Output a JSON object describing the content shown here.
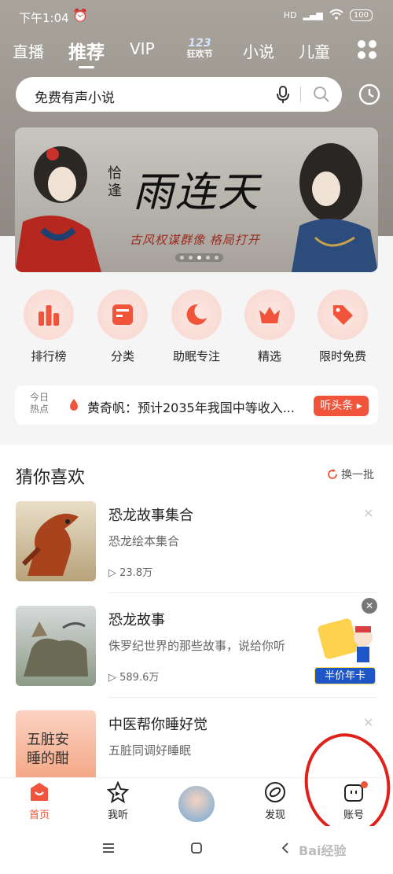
{
  "status_bar": {
    "time": "下午1:04",
    "network": "HD",
    "battery": "100"
  },
  "nav": {
    "tabs": [
      "直播",
      "推荐",
      "VIP",
      "小说",
      "儿童"
    ],
    "active_tab": "推荐",
    "festival_badge_number": "123",
    "festival_badge_text": "狂欢节"
  },
  "search": {
    "placeholder": "免费有声小说"
  },
  "banner": {
    "title": "雨连天",
    "subtitle": "恰逢",
    "slogan": "古风权谋群像 格局打开",
    "dot_count": 5,
    "active_dot": 2
  },
  "quick_entries": [
    {
      "label": "排行榜",
      "icon": "bar-chart-icon"
    },
    {
      "label": "分类",
      "icon": "category-icon"
    },
    {
      "label": "助眠专注",
      "icon": "moon-icon"
    },
    {
      "label": "精选",
      "icon": "crown-icon"
    },
    {
      "label": "限时免费",
      "icon": "tag-icon"
    }
  ],
  "news": {
    "tag_line1": "今日",
    "tag_line2": "热点",
    "headline": "黄奇帆：预计2035年我国中等收入...",
    "button": "听头条 ▸"
  },
  "guess": {
    "title": "猜你喜欢",
    "refresh": "换一批",
    "items": [
      {
        "title": "恐龙故事集合",
        "desc": "恐龙绘本集合",
        "plays": "23.8万"
      },
      {
        "title": "恐龙故事",
        "desc": "侏罗纪世界的那些故事，说给你听",
        "plays": "589.6万"
      },
      {
        "title": "中医帮你睡好觉",
        "desc": "五脏同调好睡眠",
        "plays": "",
        "cover_text": "五脏安睡的酣"
      }
    ]
  },
  "promo": {
    "label": "半价年卡"
  },
  "bottom_nav": {
    "items": [
      "首页",
      "我听",
      "发现",
      "账号"
    ],
    "active": "首页"
  },
  "watermark": "Bai经验",
  "colors": {
    "accent": "#f0553b",
    "annotation_red": "#e0201a"
  }
}
